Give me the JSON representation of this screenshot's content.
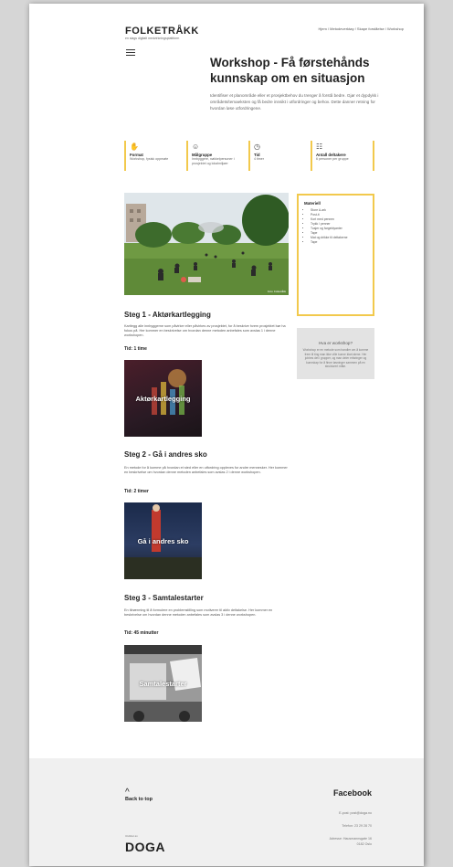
{
  "header": {
    "logo": "FOLKETRÅKK",
    "logo_sub": "en slags digitalt medvirkningsplattform",
    "breadcrumb": "Hjem / Metodeverktøy / Skape forståelse / Workshop"
  },
  "menu_icon": "hamburger-icon",
  "page": {
    "title": "Workshop - Få førstehånds kunnskap om en situasjon",
    "intro": "Identifiser et planområde eller et prosjektbehov du trenger å forstå bedre. Gjør et dypdykk i områdets/temaeksten og få bedre innsikt i utfordringer og behov. Dette danner retning for hvordan løse utfordringene."
  },
  "facts": [
    {
      "icon": "hand-icon",
      "glyph": "✋",
      "title": "Format",
      "desc": "Workshop, fysisk oppmøte"
    },
    {
      "icon": "person-icon",
      "glyph": "☺",
      "title": "Målgruppe",
      "desc": "Innbyggere, nøkkelpersoner i prosjektet og lokalmiljøer"
    },
    {
      "icon": "clock-icon",
      "glyph": "◷",
      "title": "Tid",
      "desc": "4 timer"
    },
    {
      "icon": "group-icon",
      "glyph": "☷",
      "title": "Antall deltakere",
      "desc": "6 personer per gruppe"
    }
  ],
  "materials": {
    "title": "Materiell",
    "items": [
      "Store A-ark",
      "Post-it",
      "Kort med pennen",
      "Trykk / penner",
      "Tusjer og fargeblyanter",
      "Tape",
      "Mat og drikke til deltakerne",
      "Tape"
    ]
  },
  "what_box": {
    "title": "Hva er workshop?",
    "text": "Workshop er en metode som handler om å komme frem til ting man ikke ville kunne klart alene. Her jobbes det i grupper, og man deler erfaringer og kunnskap for å finne løsninger sammen på en strukturert måte."
  },
  "steps": [
    {
      "heading": "Steg 1 - Aktørkartlegging",
      "desc": "Kartlegg alle innbyggerne som påvirker eller påvirkes av prosjektet, for å beskrive hvem prosjektet bør ha fokus på. Her kommer en beskrivelse om hvordan denne metoden anbefales som avslas 1 i denne workshopen.",
      "time": "Tid: 1 time",
      "thumb_label": "Aktørkartlegging"
    },
    {
      "heading": "Steg 2 - Gå i andres sko",
      "desc": "En metode for å komme på hvordan et sted eller en utfordring oppleves for andre mennesker. Her kommer en beskrivelse om hvordan denne metoden anbefales som avslas 2 i denne workshopen.",
      "time": "Tid: 2 timer",
      "thumb_label": "Gå i andres sko"
    },
    {
      "heading": "Steg 3 - Samtalestarter",
      "desc": "En tilnærming til å formulere en problemstilling som motiverer til aktiv deltakelse. Her kommer en beskrivelse om hvordan denne metoden anbefales som avslas 3 i denne workshopen.",
      "time": "Tid: 45 minutter",
      "thumb_label": "Samtalestarter"
    }
  ],
  "photo_caption": "Foto: Folketråkk",
  "footer": {
    "back_to_top": "Back to top",
    "doga_caption": "Utviklet av",
    "doga": "DOGA",
    "facebook": "Facebook",
    "email": "E-post: post@doga.no",
    "phone": "Telefon: 23 29 28 70",
    "address": "Adresse: Hausmannsgate 16",
    "postcode": "0182 Oslo"
  },
  "colors": {
    "accent": "#f2c94c",
    "footer_bg": "#f0f0f0",
    "box_bg": "#e3e3e3"
  }
}
